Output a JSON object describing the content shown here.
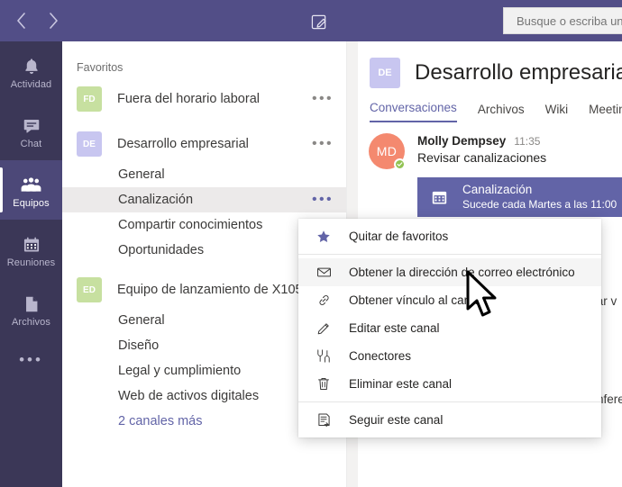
{
  "titlebar": {
    "back_icon": "chevron-left-icon",
    "forward_icon": "chevron-right-icon",
    "compose_icon": "compose-icon",
    "search_placeholder": "Busque o escriba un comando"
  },
  "rail": {
    "items": [
      {
        "label": "Actividad",
        "icon": "bell-icon",
        "active": false
      },
      {
        "label": "Chat",
        "icon": "chat-icon",
        "active": false
      },
      {
        "label": "Equipos",
        "icon": "people-icon",
        "active": true
      },
      {
        "label": "Reuniones",
        "icon": "calendar-icon",
        "active": false
      },
      {
        "label": "Archivos",
        "icon": "files-icon",
        "active": false
      }
    ],
    "more_label": "•••"
  },
  "teams_panel": {
    "section_label": "Favoritos",
    "ellipsis": "•••",
    "teams": [
      {
        "initials": "FD",
        "name": "Fuera del horario laboral",
        "avatar_color": "#c7e0a0",
        "channels": []
      },
      {
        "initials": "DE",
        "name": "Desarrollo empresarial",
        "avatar_color": "#c8c6f0",
        "channels": [
          {
            "name": "General",
            "selected": false
          },
          {
            "name": "Canalización",
            "selected": true
          },
          {
            "name": "Compartir conocimientos",
            "selected": false
          },
          {
            "name": "Oportunidades",
            "selected": false
          }
        ]
      },
      {
        "initials": "ED",
        "name": "Equipo de lanzamiento de X1050",
        "avatar_color": "#c7e0a0",
        "channels": [
          {
            "name": "General",
            "selected": false
          },
          {
            "name": "Diseño",
            "selected": false
          },
          {
            "name": "Legal y cumplimiento",
            "selected": false
          },
          {
            "name": "Web de activos digitales",
            "selected": false
          }
        ],
        "more_channels_label": "2 canales más"
      }
    ]
  },
  "main": {
    "channel_initials": "DE",
    "channel_title": "Desarrollo empresarial",
    "tabs": [
      {
        "label": "Conversaciones",
        "active": true
      },
      {
        "label": "Archivos",
        "active": false
      },
      {
        "label": "Wiki",
        "active": false
      },
      {
        "label": "Meetings",
        "active": false
      }
    ],
    "message": {
      "avatar_initials": "MD",
      "author": "Molly Dempsey",
      "time": "11:35",
      "text": "Revisar canalizaciones",
      "presence_icon": "available-check-icon"
    },
    "meeting_card": {
      "icon": "calendar-icon",
      "title": "Canalización",
      "subtitle": "Sucede cada Martes a las 11:00"
    },
    "clipped_text": {
      "line_a": "zar v",
      "line_b": "nfere"
    }
  },
  "context_menu": {
    "items": [
      {
        "label": "Quitar de favoritos",
        "icon": "star-filled-icon",
        "hover": false,
        "separator_after": true
      },
      {
        "label": "Obtener la dirección de correo electrónico",
        "icon": "envelope-icon",
        "hover": true,
        "separator_after": false
      },
      {
        "label": "Obtener vínculo al canal",
        "icon": "link-icon",
        "hover": false,
        "separator_after": false
      },
      {
        "label": "Editar este canal",
        "icon": "pencil-icon",
        "hover": false,
        "separator_after": false
      },
      {
        "label": "Conectores",
        "icon": "connectors-icon",
        "hover": false,
        "separator_after": false
      },
      {
        "label": "Eliminar este canal",
        "icon": "trash-icon",
        "hover": false,
        "separator_after": true
      },
      {
        "label": "Seguir este canal",
        "icon": "follow-channel-icon",
        "hover": false,
        "separator_after": false
      }
    ]
  },
  "colors": {
    "titlebar": "#524e87",
    "rail": "#3b3757",
    "rail_active": "#4c4878",
    "accent": "#6264a7",
    "selected_row": "#eceaea",
    "presence_available": "#92c353"
  }
}
